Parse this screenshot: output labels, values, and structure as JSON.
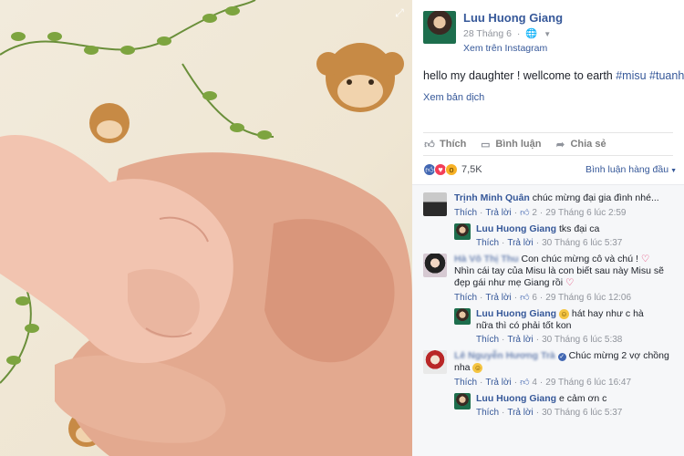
{
  "photo": {
    "expand_icon": "expand-icon"
  },
  "post": {
    "author": "Luu Huong Giang",
    "date": "28 Tháng 6",
    "source_link": "Xem trên Instagram",
    "text_plain": "hello my daughter ! wellcome to earth ",
    "hashtags": [
      "#misu",
      "#tuanh"
    ],
    "translate": "Xem bản dịch"
  },
  "actions": {
    "like": "Thích",
    "comment": "Bình luận",
    "share": "Chia sẻ"
  },
  "reactions": {
    "count": "7,5K",
    "sort_label": "Bình luận hàng đầu"
  },
  "comments": [
    {
      "author": "Trịnh Minh Quân",
      "text": "chúc mừng đại gia đình nhé...",
      "like": "Thích",
      "reply": "Trả lời",
      "likes": "2",
      "time": "29 Tháng 6 lúc 2:59"
    },
    {
      "author": "Luu Huong Giang",
      "text": "tks đại ca",
      "like": "Thích",
      "reply": "Trả lời",
      "time": "30 Tháng 6 lúc 5:37"
    },
    {
      "author": "Hà Vô Thị Thu",
      "text": "Con chúc mừng cô và chú !",
      "text2": "Nhìn cái tay của Misu là con biết sau này Misu sẽ đẹp gái như mẹ Giang rồi",
      "like": "Thích",
      "reply": "Trả lời",
      "likes": "6",
      "time": "29 Tháng 6 lúc 12:06"
    },
    {
      "author": "Luu Huong Giang",
      "text": "hát hay như c hà",
      "text2": "nữa thì có phải tốt kon",
      "like": "Thích",
      "reply": "Trả lời",
      "time": "30 Tháng 6 lúc 5:38"
    },
    {
      "author": "Lê Nguyễn Hương Trà",
      "text": "Chúc mừng 2 vợ chồng",
      "text2": "nha",
      "like": "Thích",
      "reply": "Trả lời",
      "likes": "4",
      "time": "29 Tháng 6 lúc 16:47"
    },
    {
      "author": "Luu Huong Giang",
      "text": "e cảm ơn c",
      "like": "Thích",
      "reply": "Trả lời",
      "time": "30 Tháng 6 lúc 5:37"
    }
  ]
}
